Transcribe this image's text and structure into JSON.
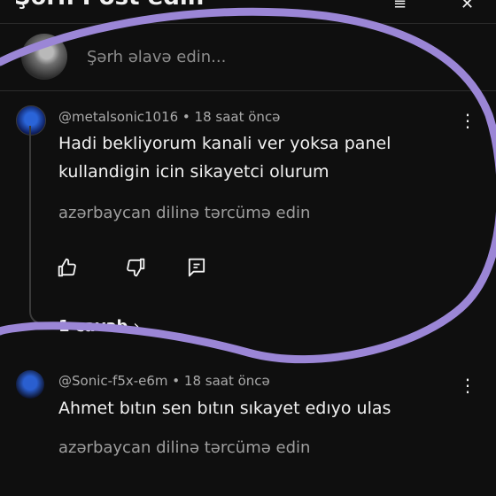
{
  "header": {
    "title": "Şərh Post edin"
  },
  "composer": {
    "placeholder": "Şərh əlavə edin..."
  },
  "comments": [
    {
      "meta": "@metalsonic1016 • 18 saat öncə",
      "lines": [
        "Hadi bekliyorum kanali ver yoksa panel",
        "kullandigin icin sikayetci olurum"
      ],
      "translate": "azərbaycan dilinə tərcümə edin",
      "replies": "1 cavab",
      "icons": [
        "like-icon",
        "dislike-icon",
        "reply-icon",
        "more-vert-icon"
      ]
    },
    {
      "meta": "@Sonic-f5x-e6m • 18 saat öncə",
      "lines": [
        "Ahmet bıtın sen bıtın sıkayet edıyo ulas"
      ],
      "translate": "azərbaycan dilinə tərcümə edin"
    }
  ],
  "colors": {
    "background": "#0f0f0f",
    "text": "#f1f1f1",
    "secondary": "#aaaaaa",
    "annotation": "#9b86d6"
  }
}
